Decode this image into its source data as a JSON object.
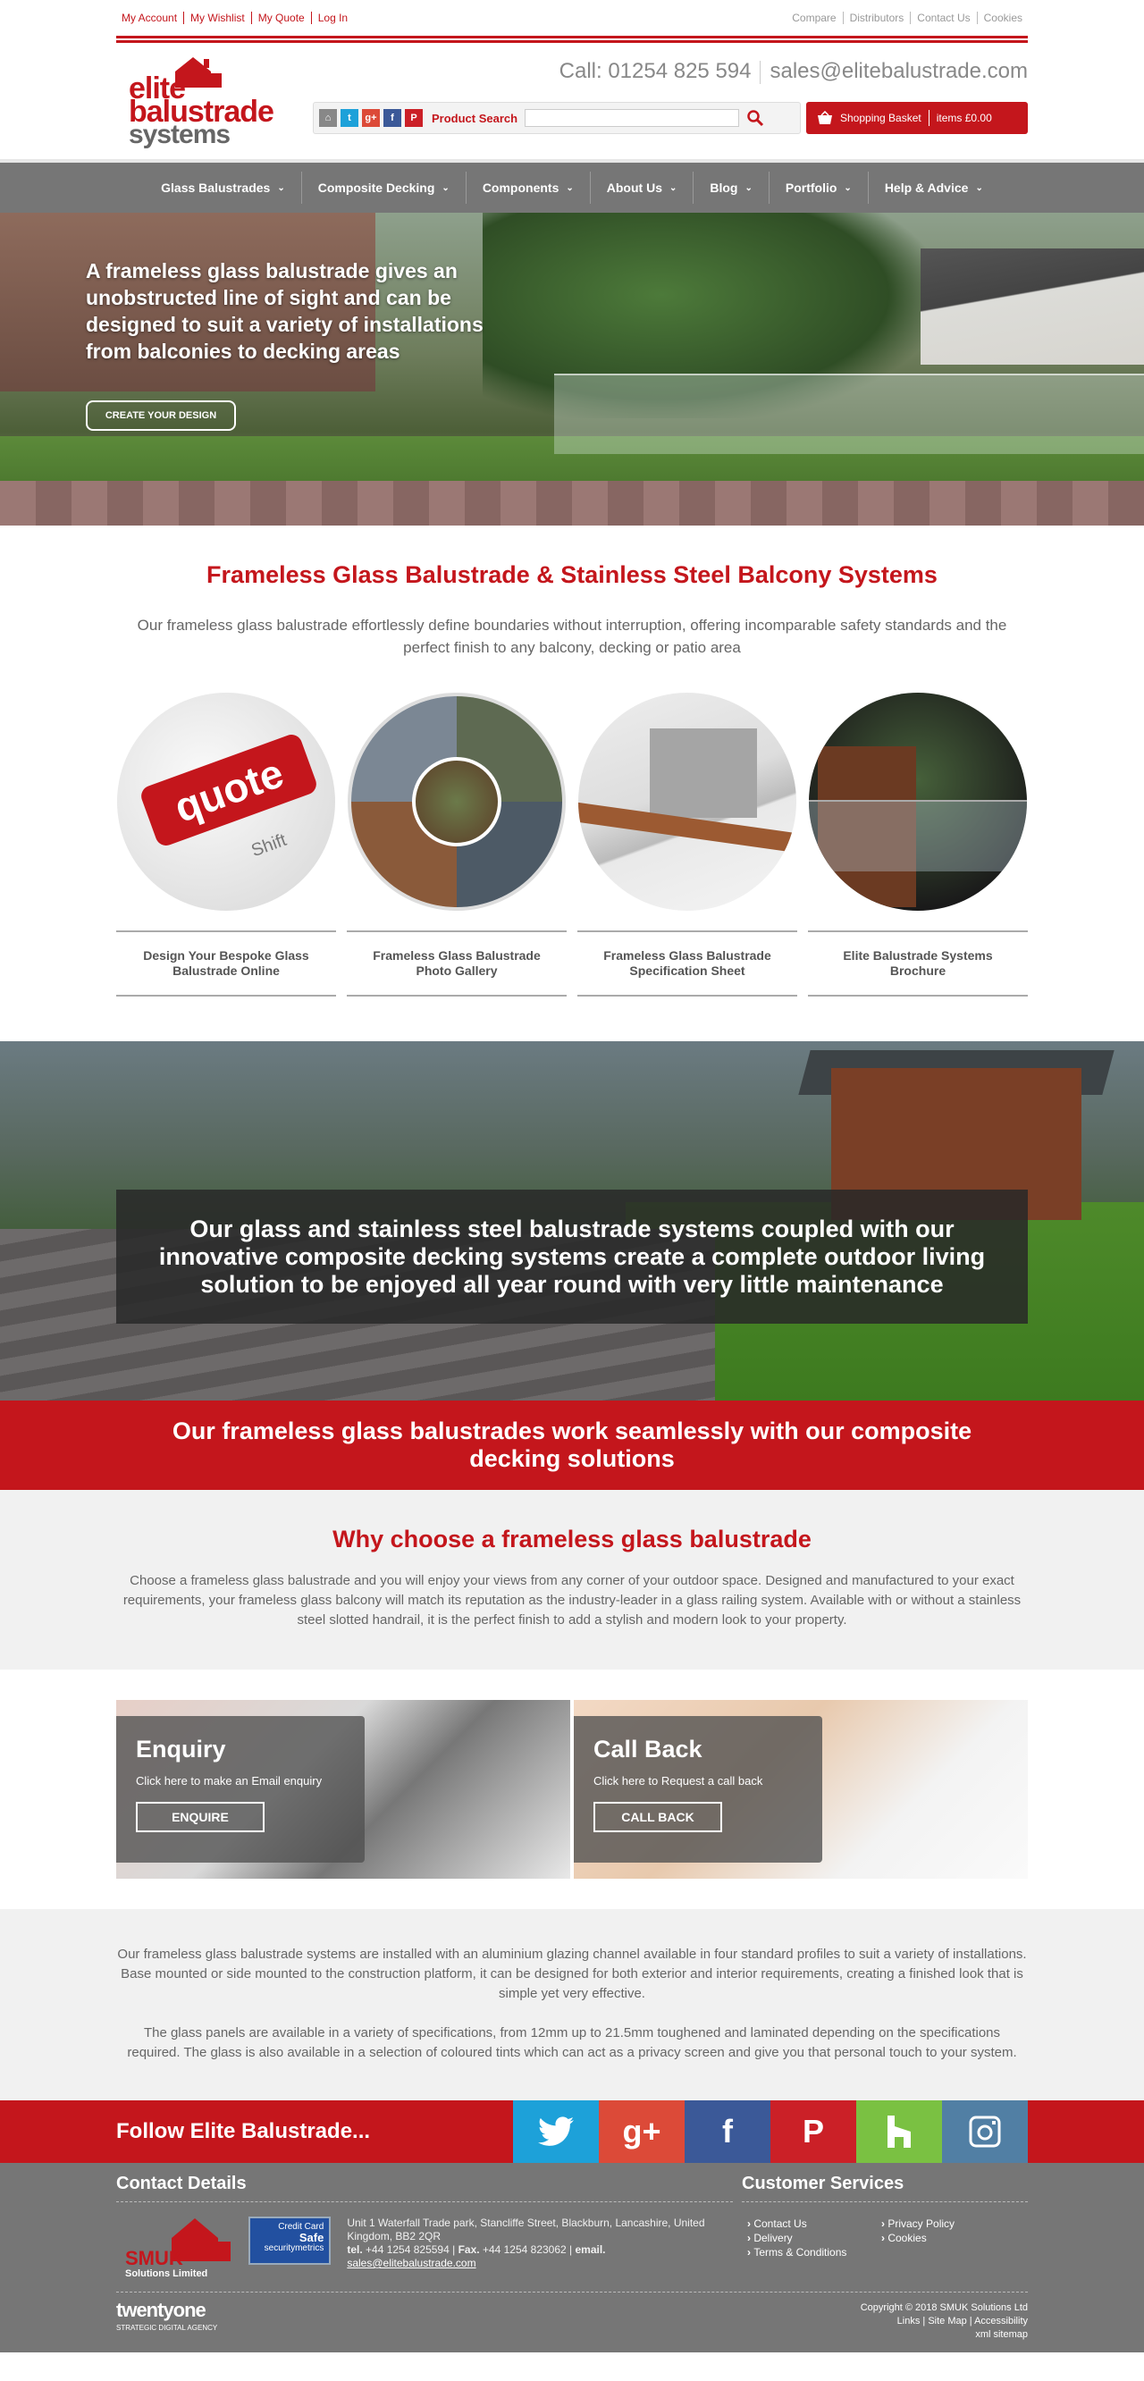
{
  "topbar": {
    "left": [
      "My Account",
      "My Wishlist",
      "My Quote",
      "Log In"
    ],
    "right": [
      "Compare",
      "Distributors",
      "Contact Us",
      "Cookies"
    ]
  },
  "header": {
    "logo": {
      "line1": "elite",
      "line2": "balustrade",
      "line3": "systems"
    },
    "phone": "Call: 01254 825 594",
    "email": "sales@elitebalustrade.com",
    "search_label": "Product Search",
    "search_value": "",
    "basket_label": "Shopping Basket",
    "basket_items": "items £0.00"
  },
  "nav": [
    "Glass Balustrades",
    "Composite Decking",
    "Components",
    "About Us",
    "Blog",
    "Portfolio",
    "Help & Advice"
  ],
  "hero": {
    "headline": "A frameless glass balustrade gives an unobstructed line of sight and can be designed to suit a variety of installations from balconies to decking areas",
    "button": "CREATE YOUR DESIGN"
  },
  "intro": {
    "title": "Frameless Glass Balustrade & Stainless Steel Balcony Systems",
    "text": "Our frameless glass balustrade effortlessly define boundaries without interruption, offering incomparable safety standards and the perfect finish to any balcony, decking or patio area",
    "quote_key": "quote",
    "shift_key": "Shift",
    "cards": [
      "Design Your Bespoke Glass Balustrade Online",
      "Frameless Glass Balustrade Photo Gallery",
      "Frameless Glass Balustrade Specification Sheet",
      "Elite Balustrade Systems Brochure"
    ]
  },
  "decking": {
    "overlay": "Our glass and stainless steel balustrade systems coupled with our innovative composite decking systems create a complete outdoor living solution to be enjoyed all year round with very little maintenance",
    "red_banner": "Our frameless glass balustrades work seamlessly with our composite decking solutions"
  },
  "why": {
    "title": "Why choose a frameless glass balustrade",
    "text": "Choose a frameless glass balustrade and you will enjoy your views from any corner of your outdoor space. Designed and manufactured to your exact requirements, your frameless glass balcony will match its reputation as the industry-leader in a glass railing system. Available with or without a stainless steel slotted handrail, it is the perfect finish to add a stylish and modern look to your property."
  },
  "cta": [
    {
      "title": "Enquiry",
      "text": "Click here to make an Email enquiry",
      "button": "ENQUIRE"
    },
    {
      "title": "Call Back",
      "text": "Click here to Request a call back",
      "button": "CALL BACK"
    }
  ],
  "info": [
    "Our frameless glass balustrade systems are installed with an aluminium glazing channel available in four standard profiles to suit a variety of installations. Base mounted or side mounted to the construction platform, it can be designed for both exterior and interior requirements, creating a finished look that is simple yet very effective.",
    "The glass panels are available in a variety of specifications, from 12mm up to 21.5mm toughened and laminated depending on the specifications required. The glass is also available in a selection of coloured tints which can act as a privacy screen and give you that personal touch to your system."
  ],
  "follow": {
    "text": "Follow Elite Balustrade...",
    "networks": [
      {
        "name": "twitter-icon",
        "glyph": "🐦",
        "color": "#1da1d9"
      },
      {
        "name": "google-plus-icon",
        "glyph": "g+",
        "color": "#dc4a38"
      },
      {
        "name": "facebook-icon",
        "glyph": "f",
        "color": "#3b5998"
      },
      {
        "name": "pinterest-icon",
        "glyph": "P",
        "color": "#cb2027"
      },
      {
        "name": "houzz-icon",
        "glyph": "h",
        "color": "#7ac142"
      },
      {
        "name": "instagram-icon",
        "glyph": "◙",
        "color": "#517fa4"
      }
    ]
  },
  "footer": {
    "contact_title": "Contact Details",
    "smuk": "SMUK",
    "smuk_sub": "Solutions Limited",
    "cc_line1": "Credit Card",
    "cc_line2": "Safe",
    "cc_line3": "securitymetrics",
    "address": "Unit 1 Waterfall Trade park, Stancliffe Street, Blackburn, Lancashire, United Kingdom, BB2 2QR",
    "tel_label": "tel.",
    "tel": "+44 1254 825594",
    "fax_label": "Fax.",
    "fax": "+44 1254 823062",
    "email_label": "email.",
    "email": "sales@elitebalustrade.com",
    "services_title": "Customer Services",
    "links": [
      "Contact Us",
      "Privacy Policy",
      "Delivery",
      "Cookies",
      "Terms & Conditions"
    ],
    "agency": "twentyone",
    "agency_sub": "STRATEGIC DIGITAL AGENCY",
    "copyright": "Copyright © 2018 SMUK Solutions Ltd",
    "bottom_links": "Links | Site Map | Accessibility",
    "sitemap": "xml sitemap"
  },
  "colors": {
    "brand_red": "#c4161c",
    "nav_grey": "#767676"
  }
}
